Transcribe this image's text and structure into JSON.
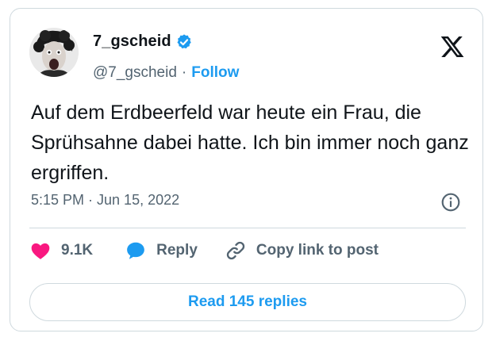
{
  "author": {
    "display_name": "7_gscheid",
    "handle": "@7_gscheid",
    "separator": "·",
    "follow_label": "Follow",
    "verified_icon": "verified-badge-icon"
  },
  "tweet": {
    "text": "Auf dem Erdbeerfeld war heute ein Frau, die Sprühsahne dabei hatte. Ich bin immer noch ganz ergriffen.",
    "timestamp": "5:15 PM · Jun 15, 2022"
  },
  "actions": {
    "like_count": "9.1K",
    "reply_label": "Reply",
    "copy_link_label": "Copy link to post"
  },
  "read_replies_label": "Read 145 replies",
  "colors": {
    "accent": "#1d9bf0",
    "like": "#f91880",
    "text": "#0f1419",
    "secondary": "#536471",
    "border": "#cfd9de"
  }
}
